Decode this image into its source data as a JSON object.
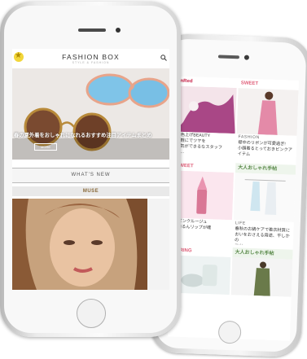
{
  "front": {
    "brand": "FASHION BOX",
    "brand_subtitle": "STYLE & FASHION",
    "logo_subtitle": "",
    "hero_text": "春の夏外着をおしゃれになれるおすすめ注目アイテムまとめ",
    "hero_button": "MORE",
    "whats_new": "WHAT'S NEW",
    "muse_title": "MUSE"
  },
  "back": {
    "left": [
      {
        "head": "InRed",
        "head_color": "#c8244a",
        "caption": "で色上げBEAUTY\n手軽にでツヤを\n活気ができるなスタッフ\n(M..."
      },
      {
        "head": "SWEET",
        "head_color": "#e0607a",
        "caption": "ⅡTピンクルージュ\nで自るんリップが確\n保"
      },
      {
        "head": "SPRING",
        "head_color": "#e0607a",
        "caption": ""
      }
    ],
    "right": [
      {
        "head": "SWEET",
        "head_color": "#e0607a",
        "category": "FASHION",
        "caption": "襟中のリボンが可愛過ぎ!\n小顔着るとっておきピンクアイテム"
      },
      {
        "head": "大人おしゃれ手帖",
        "head_color": "#5a8a4a",
        "category": "LIFE",
        "caption": "春秋のお鍋ケアで着衣材質に\nおいをおさえる用途、干しかの\nコツ"
      },
      {
        "head": "大人おしゃれ手帖",
        "head_color": "#5a8a4a",
        "category": "",
        "caption": ""
      }
    ]
  },
  "colors": {
    "accent_pink": "#e0607a",
    "gold": "#f2d63a"
  }
}
